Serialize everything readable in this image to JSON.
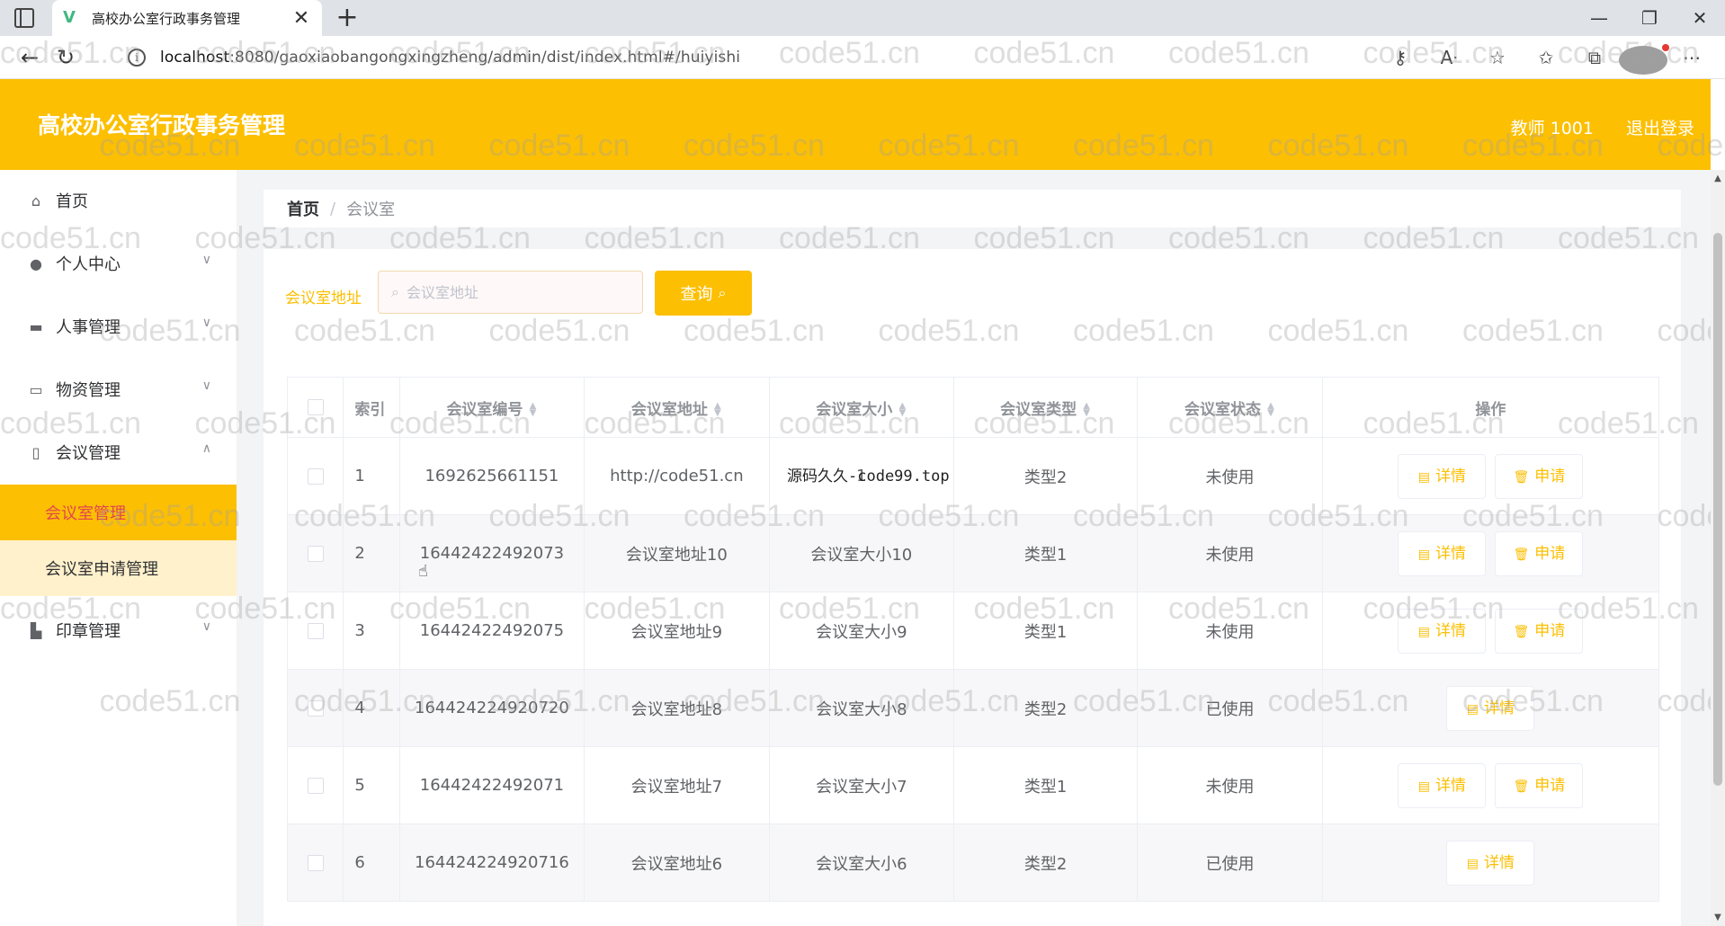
{
  "browser": {
    "tab_title": "高校办公室行政事务管理",
    "tab_favicon": "V",
    "tab_close": "✕",
    "new_tab": "+",
    "url_host": "localhost",
    "url_rest": ":8080/gaoxiaobangongxingzheng/admin/dist/index.html#/huiyishi",
    "window_controls": [
      "—",
      "❐",
      "✕"
    ]
  },
  "header": {
    "title": "高校办公室行政事务管理",
    "user": "教师 1001",
    "logout": "退出登录"
  },
  "sidebar": {
    "items": [
      {
        "label": "首页",
        "icon": "home-icon"
      },
      {
        "label": "个人中心",
        "icon": "user-icon"
      },
      {
        "label": "人事管理",
        "icon": "briefcase-icon"
      },
      {
        "label": "物资管理",
        "icon": "card-icon"
      },
      {
        "label": "会议管理",
        "icon": "meeting-icon"
      },
      {
        "label": "印章管理",
        "icon": "stamp-icon"
      }
    ],
    "sub_items": [
      "会议室管理",
      "会议室申请管理"
    ]
  },
  "breadcrumb": {
    "home": "首页",
    "separator": "/",
    "current": "会议室"
  },
  "search": {
    "label": "会议室地址",
    "placeholder": "会议室地址",
    "button": "查询"
  },
  "table": {
    "headers": [
      "索引",
      "会议室编号",
      "会议室地址",
      "会议室大小",
      "会议室类型",
      "会议室状态",
      "操作"
    ],
    "rows": [
      {
        "index": "1",
        "code": "1692625661151",
        "address": "http://code51.cn",
        "size": "1",
        "type": "类型2",
        "status": "未使用",
        "actions": [
          "详情",
          "申请"
        ]
      },
      {
        "index": "2",
        "code": "16442422492073",
        "address": "会议室地址10",
        "size": "会议室大小10",
        "type": "类型1",
        "status": "未使用",
        "actions": [
          "详情",
          "申请"
        ]
      },
      {
        "index": "3",
        "code": "16442422492075",
        "address": "会议室地址9",
        "size": "会议室大小9",
        "type": "类型1",
        "status": "未使用",
        "actions": [
          "详情",
          "申请"
        ]
      },
      {
        "index": "4",
        "code": "164424224920720",
        "address": "会议室地址8",
        "size": "会议室大小8",
        "type": "类型2",
        "status": "已使用",
        "actions": [
          "详情"
        ]
      },
      {
        "index": "5",
        "code": "16442422492071",
        "address": "会议室地址7",
        "size": "会议室大小7",
        "type": "类型1",
        "status": "未使用",
        "actions": [
          "详情",
          "申请"
        ]
      },
      {
        "index": "6",
        "code": "164424224920716",
        "address": "会议室地址6",
        "size": "会议室大小6",
        "type": "类型2",
        "status": "已使用",
        "actions": [
          "详情"
        ]
      }
    ]
  },
  "overlay_text": "源码久久-code99.top",
  "watermark_text": "code51.cn",
  "colors": {
    "accent": "#fcbf02",
    "active_sub_text": "#e0484f",
    "sub_bg": "#fff1cc"
  }
}
